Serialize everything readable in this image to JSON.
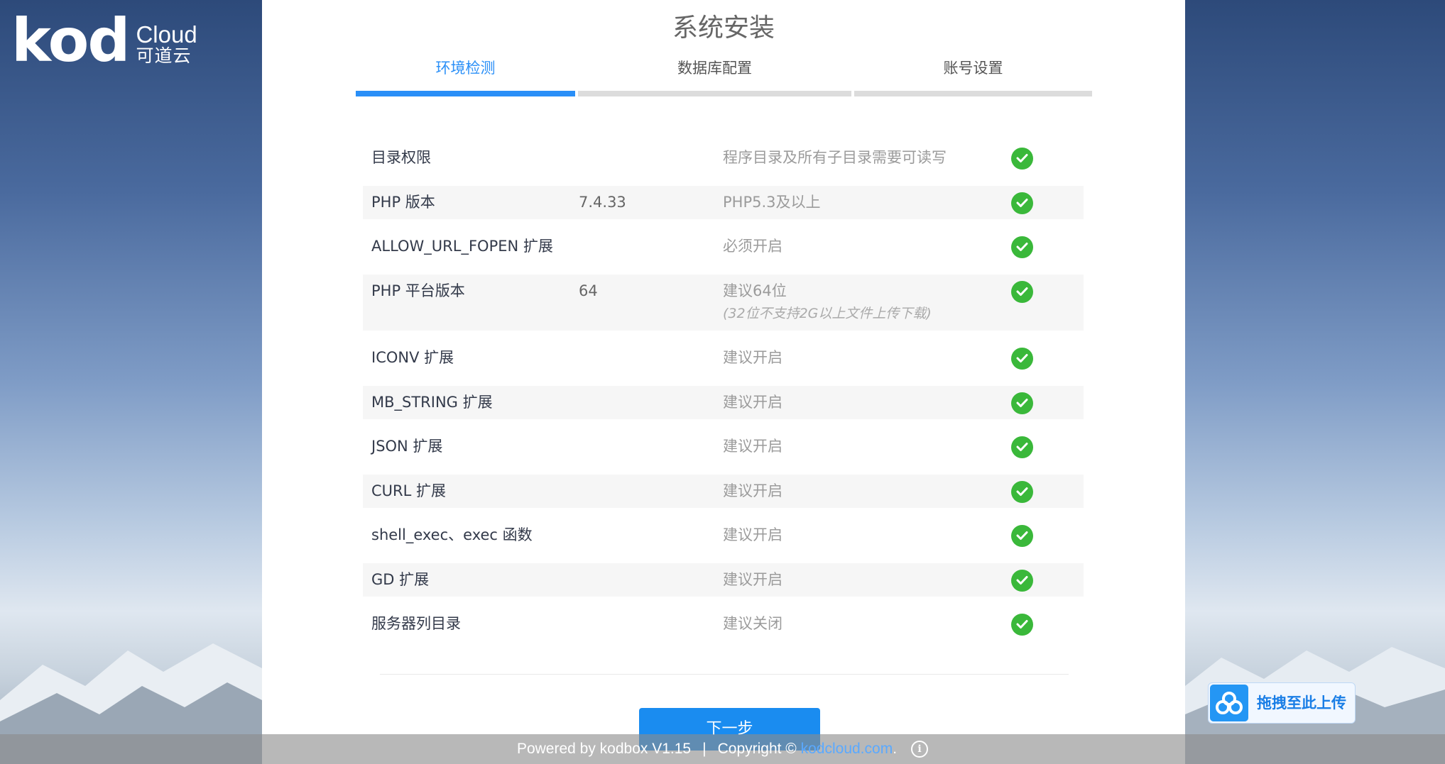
{
  "logo": {
    "mark": "kod",
    "en": "Cloud",
    "cn": "可道云"
  },
  "title": "系统安装",
  "steps": [
    {
      "label": "环境检测"
    },
    {
      "label": "数据库配置"
    },
    {
      "label": "账号设置"
    }
  ],
  "active_step": 0,
  "checks": [
    {
      "name": "目录权限",
      "value": "",
      "requirement": "程序目录及所有子目录需要可读写",
      "note": "",
      "status": "ok"
    },
    {
      "name": "PHP 版本",
      "value": "7.4.33",
      "requirement": "PHP5.3及以上",
      "note": "",
      "status": "ok"
    },
    {
      "name": "ALLOW_URL_FOPEN 扩展",
      "value": "",
      "requirement": "必须开启",
      "note": "",
      "status": "ok"
    },
    {
      "name": "PHP 平台版本",
      "value": "64",
      "requirement": "建议64位",
      "note": "(32位不支持2G以上文件上传下载)",
      "status": "ok"
    },
    {
      "name": "ICONV 扩展",
      "value": "",
      "requirement": "建议开启",
      "note": "",
      "status": "ok"
    },
    {
      "name": "MB_STRING 扩展",
      "value": "",
      "requirement": "建议开启",
      "note": "",
      "status": "ok"
    },
    {
      "name": "JSON 扩展",
      "value": "",
      "requirement": "建议开启",
      "note": "",
      "status": "ok"
    },
    {
      "name": "CURL 扩展",
      "value": "",
      "requirement": "建议开启",
      "note": "",
      "status": "ok"
    },
    {
      "name": "shell_exec、exec 函数",
      "value": "",
      "requirement": "建议开启",
      "note": "",
      "status": "ok"
    },
    {
      "name": "GD 扩展",
      "value": "",
      "requirement": "建议开启",
      "note": "",
      "status": "ok"
    },
    {
      "name": "服务器列目录",
      "value": "",
      "requirement": "建议关闭",
      "note": "",
      "status": "ok"
    }
  ],
  "next_button": "下一步",
  "footer": {
    "powered": "Powered by kodbox V1.15",
    "separator": "|",
    "copyright": "Copyright ©",
    "link": "kodcloud.com",
    "dot": "."
  },
  "upload_widget": {
    "label": "拖拽至此上传",
    "icon": "cloud-upload-icon"
  },
  "colors": {
    "accent": "#2a8ff7",
    "ok": "#3ab83a",
    "button": "#1a8cf0"
  }
}
